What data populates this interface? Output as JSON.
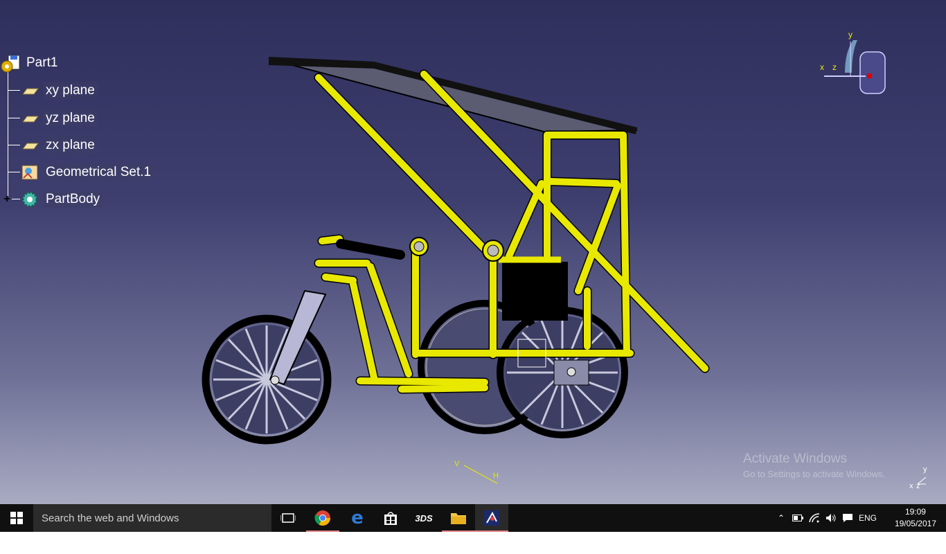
{
  "spec_tree": {
    "root": "Part1",
    "items": [
      "xy plane",
      "yz plane",
      "zx plane",
      "Geometrical Set.1",
      "PartBody"
    ]
  },
  "compass": {
    "x": "x",
    "y": "y",
    "z": "z"
  },
  "axis_mini": {
    "x": "x",
    "y": "y",
    "z": "z"
  },
  "hv": {
    "v": "V",
    "h": "H"
  },
  "watermark": {
    "title": "Activate Windows",
    "subtitle": "Go to Settings to activate Windows."
  },
  "taskbar": {
    "search_placeholder": "Search the web and Windows",
    "language": "ENG",
    "time": "19:09",
    "date": "19/05/2017"
  },
  "colors": {
    "frame": "#e8e800",
    "accent": "#e08080"
  }
}
